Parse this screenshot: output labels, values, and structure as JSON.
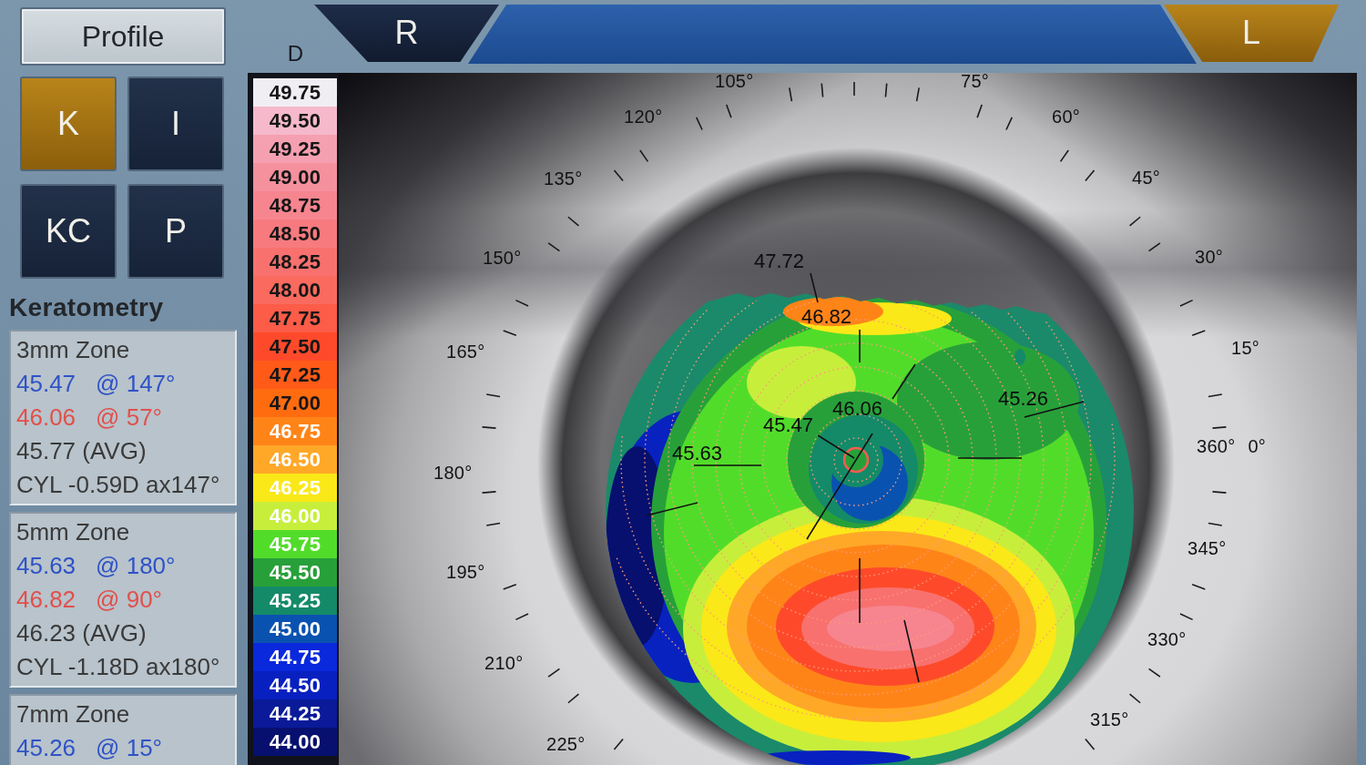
{
  "profile_button": {
    "label": "Profile"
  },
  "mode_buttons": [
    {
      "label": "K",
      "selected": true
    },
    {
      "label": "I",
      "selected": false
    },
    {
      "label": "KC",
      "selected": false
    },
    {
      "label": "P",
      "selected": false
    }
  ],
  "keratometry": {
    "title": "Keratometry",
    "zones": [
      {
        "title": "3mm Zone",
        "lines": [
          {
            "kind": "flat",
            "value": "45.47",
            "axis": "@ 147°"
          },
          {
            "kind": "steep",
            "value": "46.06",
            "axis": "@ 57°"
          },
          {
            "kind": "average",
            "value": "45.77 (AVG)"
          },
          {
            "kind": "cylinder",
            "value": "CYL -0.59D ax147°"
          }
        ]
      },
      {
        "title": "5mm Zone",
        "lines": [
          {
            "kind": "flat",
            "value": "45.63",
            "axis": "@ 180°"
          },
          {
            "kind": "steep",
            "value": "46.82",
            "axis": "@ 90°"
          },
          {
            "kind": "average",
            "value": "46.23 (AVG)"
          },
          {
            "kind": "cylinder",
            "value": "CYL -1.18D ax180°"
          }
        ]
      },
      {
        "title": "7mm Zone",
        "lines": [
          {
            "kind": "flat",
            "value": "45.26",
            "axis": "@ 15°"
          }
        ]
      }
    ]
  },
  "eye_tabs": [
    {
      "label": "R",
      "selected": false
    },
    {
      "label": "L",
      "selected": true
    }
  ],
  "scale": {
    "unit": "D",
    "steps": [
      {
        "label": "49.75",
        "color": "#f1eef3",
        "light_label": false
      },
      {
        "label": "49.50",
        "color": "#f5b9cb",
        "light_label": false
      },
      {
        "label": "49.25",
        "color": "#f5a0b0",
        "light_label": false
      },
      {
        "label": "49.00",
        "color": "#f5909d",
        "light_label": false
      },
      {
        "label": "48.75",
        "color": "#f6858f",
        "light_label": false
      },
      {
        "label": "48.50",
        "color": "#f77a7e",
        "light_label": false
      },
      {
        "label": "48.25",
        "color": "#f8716f",
        "light_label": false
      },
      {
        "label": "48.00",
        "color": "#fa6a5e",
        "light_label": false
      },
      {
        "label": "47.75",
        "color": "#fc5c48",
        "light_label": false
      },
      {
        "label": "47.50",
        "color": "#fe4a2a",
        "light_label": false
      },
      {
        "label": "47.25",
        "color": "#ff5a18",
        "light_label": false
      },
      {
        "label": "47.00",
        "color": "#ff6c10",
        "light_label": false
      },
      {
        "label": "46.75",
        "color": "#ff8418",
        "light_label": true
      },
      {
        "label": "46.50",
        "color": "#ffa828",
        "light_label": true
      },
      {
        "label": "46.25",
        "color": "#fbe818",
        "light_label": true
      },
      {
        "label": "46.00",
        "color": "#c8ee3c",
        "light_label": true
      },
      {
        "label": "45.75",
        "color": "#52dc2a",
        "light_label": true
      },
      {
        "label": "45.50",
        "color": "#28a03a",
        "light_label": true
      },
      {
        "label": "45.25",
        "color": "#148a68",
        "light_label": true
      },
      {
        "label": "45.00",
        "color": "#0a52b0",
        "light_label": true
      },
      {
        "label": "44.75",
        "color": "#0a28dc",
        "light_label": true
      },
      {
        "label": "44.50",
        "color": "#0820c0",
        "light_label": true
      },
      {
        "label": "44.25",
        "color": "#0a1a98",
        "light_label": true
      },
      {
        "label": "44.00",
        "color": "#07106e",
        "light_label": true
      }
    ]
  },
  "map": {
    "angle_labels": [
      "105°",
      "120°",
      "135°",
      "150°",
      "165°",
      "180°",
      "195°",
      "210°",
      "225°",
      "75°",
      "60°",
      "45°",
      "30°",
      "15°",
      "360° 0°",
      "345°",
      "330°",
      "315°"
    ],
    "values": [
      "47.72",
      "46.82",
      "45.26",
      "46.06",
      "45.47",
      "45.63"
    ]
  }
}
